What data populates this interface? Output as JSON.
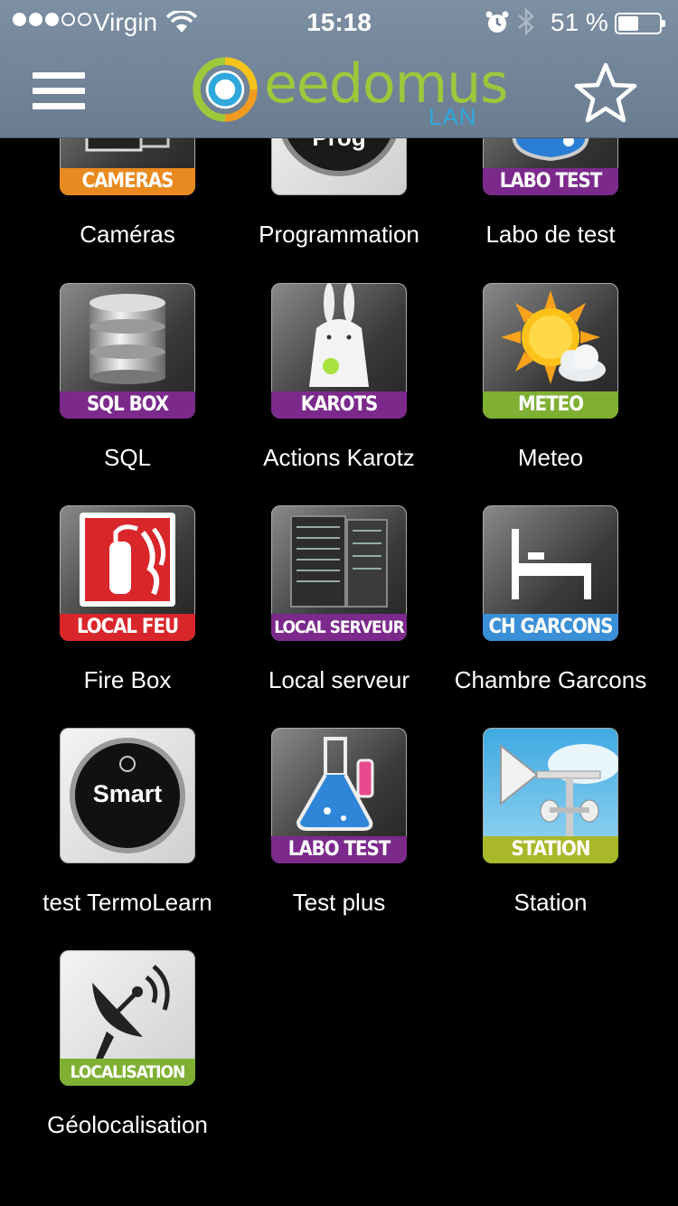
{
  "status_bar": {
    "carrier": "Virgin",
    "time": "15:18",
    "battery_percent": "51 %",
    "battery_level": 0.51,
    "signal_bars_filled": 3,
    "signal_bars_total": 5,
    "icons": [
      "wifi-icon",
      "alarm-icon",
      "bluetooth-icon",
      "battery-icon"
    ]
  },
  "header": {
    "logo_text": "eedomus",
    "logo_sub": "LAN",
    "menu_icon": "hamburger-menu-icon",
    "favorite_icon": "star-icon"
  },
  "tiles": [
    {
      "label": "Caméras",
      "banner": "CAMERAS",
      "banner_color": "#e88a1f",
      "icon": "cameras-icon"
    },
    {
      "label": "Programmation",
      "banner": "",
      "banner_color": "",
      "icon": "thermostat-icon"
    },
    {
      "label": "Labo de test",
      "banner": "LABO TEST",
      "banner_color": "#7b2a8c",
      "icon": "flask-icon"
    },
    {
      "label": "SQL",
      "banner": "SQL BOX",
      "banner_color": "#7b2a8c",
      "icon": "database-icon"
    },
    {
      "label": "Actions Karotz",
      "banner": "KAROTS",
      "banner_color": "#7b2a8c",
      "icon": "rabbit-icon"
    },
    {
      "label": "Meteo",
      "banner": "METEO",
      "banner_color": "#7fb033",
      "icon": "sun-cloud-icon"
    },
    {
      "label": "Fire Box",
      "banner": "LOCAL FEU",
      "banner_color": "#d9262a",
      "icon": "fire-extinguisher-icon"
    },
    {
      "label": "Local serveur",
      "banner": "LOCAL SERVEUR",
      "banner_color": "#7b2a8c",
      "icon": "server-rack-icon"
    },
    {
      "label": "Chambre Garcons",
      "banner": "CH GARCONS",
      "banner_color": "#3a8fd6",
      "icon": "bed-icon"
    },
    {
      "label": "test TermoLearn",
      "banner": "",
      "banner_color": "",
      "icon": "smart-thermostat-icon",
      "icon_text": "Smart"
    },
    {
      "label": "Test plus",
      "banner": "LABO TEST",
      "banner_color": "#7b2a8c",
      "icon": "flask-icon"
    },
    {
      "label": "Station",
      "banner": "STATION",
      "banner_color": "#a8b82a",
      "icon": "weather-vane-icon"
    },
    {
      "label": "Géolocalisation",
      "banner": "LOCALISATION",
      "banner_color": "#7fb033",
      "icon": "satellite-dish-icon"
    }
  ]
}
